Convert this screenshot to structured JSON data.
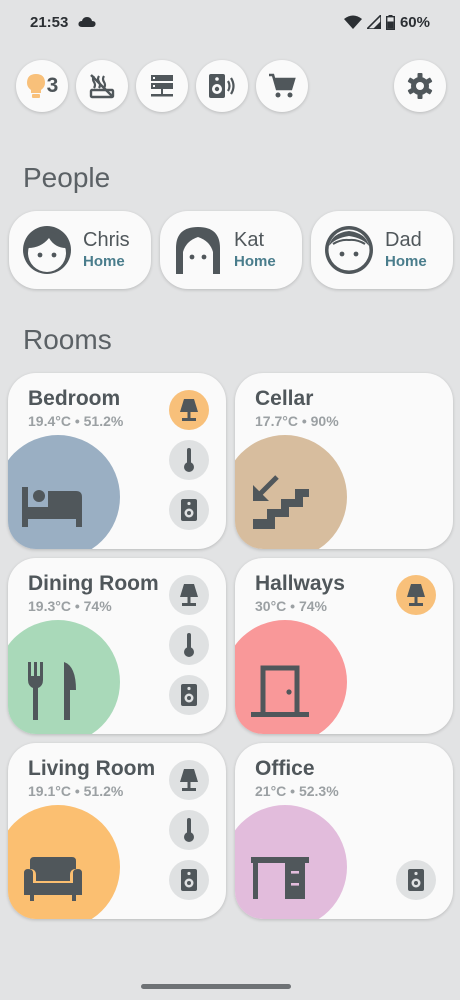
{
  "status_bar": {
    "time": "21:53",
    "battery": "60%",
    "icons": [
      "cloud-icon",
      "wifi-icon",
      "signal-icon",
      "battery-icon"
    ]
  },
  "quick_chips": {
    "lights_count": "3",
    "items": [
      "lightbulb-icon",
      "heating-off-icon",
      "server-icon",
      "speaker-icon",
      "cart-icon",
      "gear-icon"
    ]
  },
  "people": {
    "title": "People",
    "list": [
      {
        "name": "Chris",
        "status": "Home"
      },
      {
        "name": "Kat",
        "status": "Home"
      },
      {
        "name": "Dad",
        "status": "Home"
      }
    ]
  },
  "rooms": {
    "title": "Rooms",
    "list": [
      {
        "name": "Bedroom",
        "stats": "19.4°C • 51.2%",
        "icon": "bed-icon",
        "color": "#9aafc3"
      },
      {
        "name": "Cellar",
        "stats": "17.7°C • 90%",
        "icon": "stairs-down-icon",
        "color": "#d7bd9e"
      },
      {
        "name": "Dining Room",
        "stats": "19.3°C • 74%",
        "icon": "cutlery-icon",
        "color": "#a9d9b9"
      },
      {
        "name": "Hallways",
        "stats": "30°C • 74%",
        "icon": "door-icon",
        "color": "#f99899"
      },
      {
        "name": "Living Room",
        "stats": "19.1°C • 51.2%",
        "icon": "sofa-icon",
        "color": "#fbbf71"
      },
      {
        "name": "Office",
        "stats": "21°C • 52.3%",
        "icon": "desk-icon",
        "color": "#e2bcdc"
      }
    ]
  },
  "colors": {
    "background": "#e2e3e4",
    "card": "#fafafa",
    "accent_on": "#f8c07a",
    "home_status": "#4a7d8c"
  }
}
